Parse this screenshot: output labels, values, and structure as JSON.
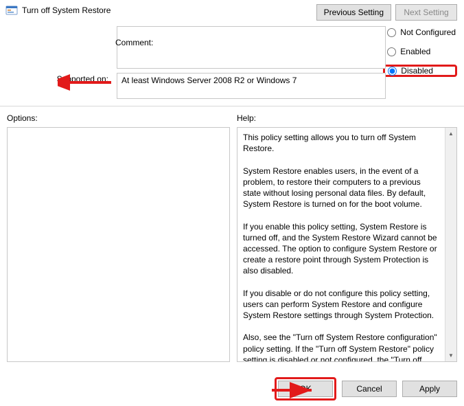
{
  "title": "Turn off System Restore",
  "buttons": {
    "previous": "Previous Setting",
    "next": "Next Setting",
    "ok": "OK",
    "cancel": "Cancel",
    "apply": "Apply"
  },
  "radios": {
    "not_configured": "Not Configured",
    "enabled": "Enabled",
    "disabled": "Disabled",
    "selected": "disabled"
  },
  "labels": {
    "comment": "Comment:",
    "supported_on": "Supported on:",
    "options": "Options:",
    "help": "Help:"
  },
  "comment_value": "",
  "supported_value": "At least Windows Server 2008 R2 or Windows 7",
  "help_text": "This policy setting allows you to turn off System Restore.\n\nSystem Restore enables users, in the event of a problem, to restore their computers to a previous state without losing personal data files. By default, System Restore is turned on for the boot volume.\n\nIf you enable this policy setting, System Restore is turned off, and the System Restore Wizard cannot be accessed. The option to configure System Restore or create a restore point through System Protection is also disabled.\n\nIf you disable or do not configure this policy setting, users can perform System Restore and configure System Restore settings through System Protection.\n\nAlso, see the \"Turn off System Restore configuration\" policy setting. If the \"Turn off System Restore\" policy setting is disabled or not configured, the \"Turn off System Restore configuration\" policy setting is used to determine whether the option to configure System Restore is available."
}
